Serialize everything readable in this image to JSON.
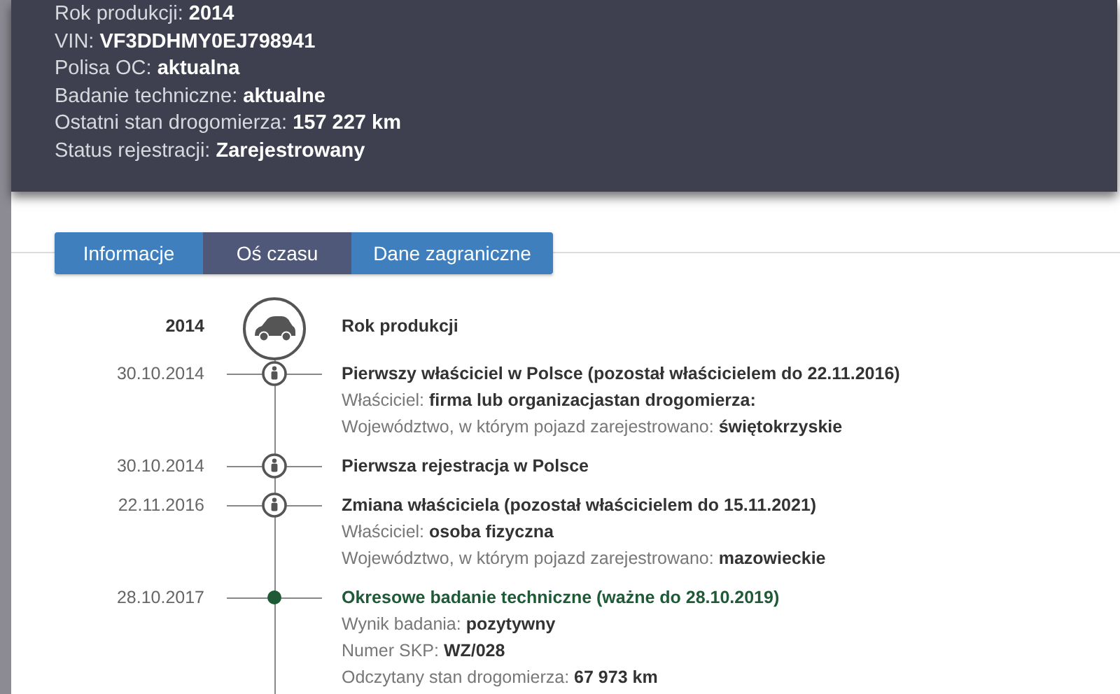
{
  "summary": [
    "Rok produkcji: **2014**",
    "VIN: **VF3DDHMY0EJ798941**",
    "Polisa OC: **aktualna**",
    "Badanie techniczne: **aktualne**",
    "Ostatni stan drogomierza: **157 227 km**",
    "Status rejestracji: **Zarejestrowany**"
  ],
  "tabs": [
    {
      "label": "Informacje",
      "selected": false
    },
    {
      "label": "Oś czasu",
      "selected": true
    },
    {
      "label": "Dane zagraniczne",
      "selected": false
    }
  ],
  "timeline": [
    {
      "kind": "year",
      "date": "2014",
      "title": "Rok produkcji"
    },
    {
      "kind": "owner",
      "date": "30.10.2014",
      "title": "Pierwszy właściciel w Polsce (pozostał właścicielem do 22.11.2016)",
      "details": [
        "Właściciel: **firma lub organizacjastan drogomierza:**",
        "Województwo, w którym pojazd zarejestrowano: **świętokrzyskie**"
      ]
    },
    {
      "kind": "owner",
      "date": "30.10.2014",
      "title": "Pierwsza rejestracja w Polsce"
    },
    {
      "kind": "owner",
      "date": "22.11.2016",
      "title": "Zmiana właściciela (pozostał właścicielem do 15.11.2021)",
      "details": [
        "Właściciel: **osoba fizyczna**",
        "Województwo, w którym pojazd zarejestrowano: **mazowieckie**"
      ]
    },
    {
      "kind": "inspection",
      "date": "28.10.2017",
      "title": "Okresowe badanie techniczne (ważne do 28.10.2019)",
      "details": [
        "Wynik badania: **pozytywny**",
        "Numer SKP: **WZ/028**",
        "Odczytany stan drogomierza: **67 973 km**"
      ]
    }
  ]
}
